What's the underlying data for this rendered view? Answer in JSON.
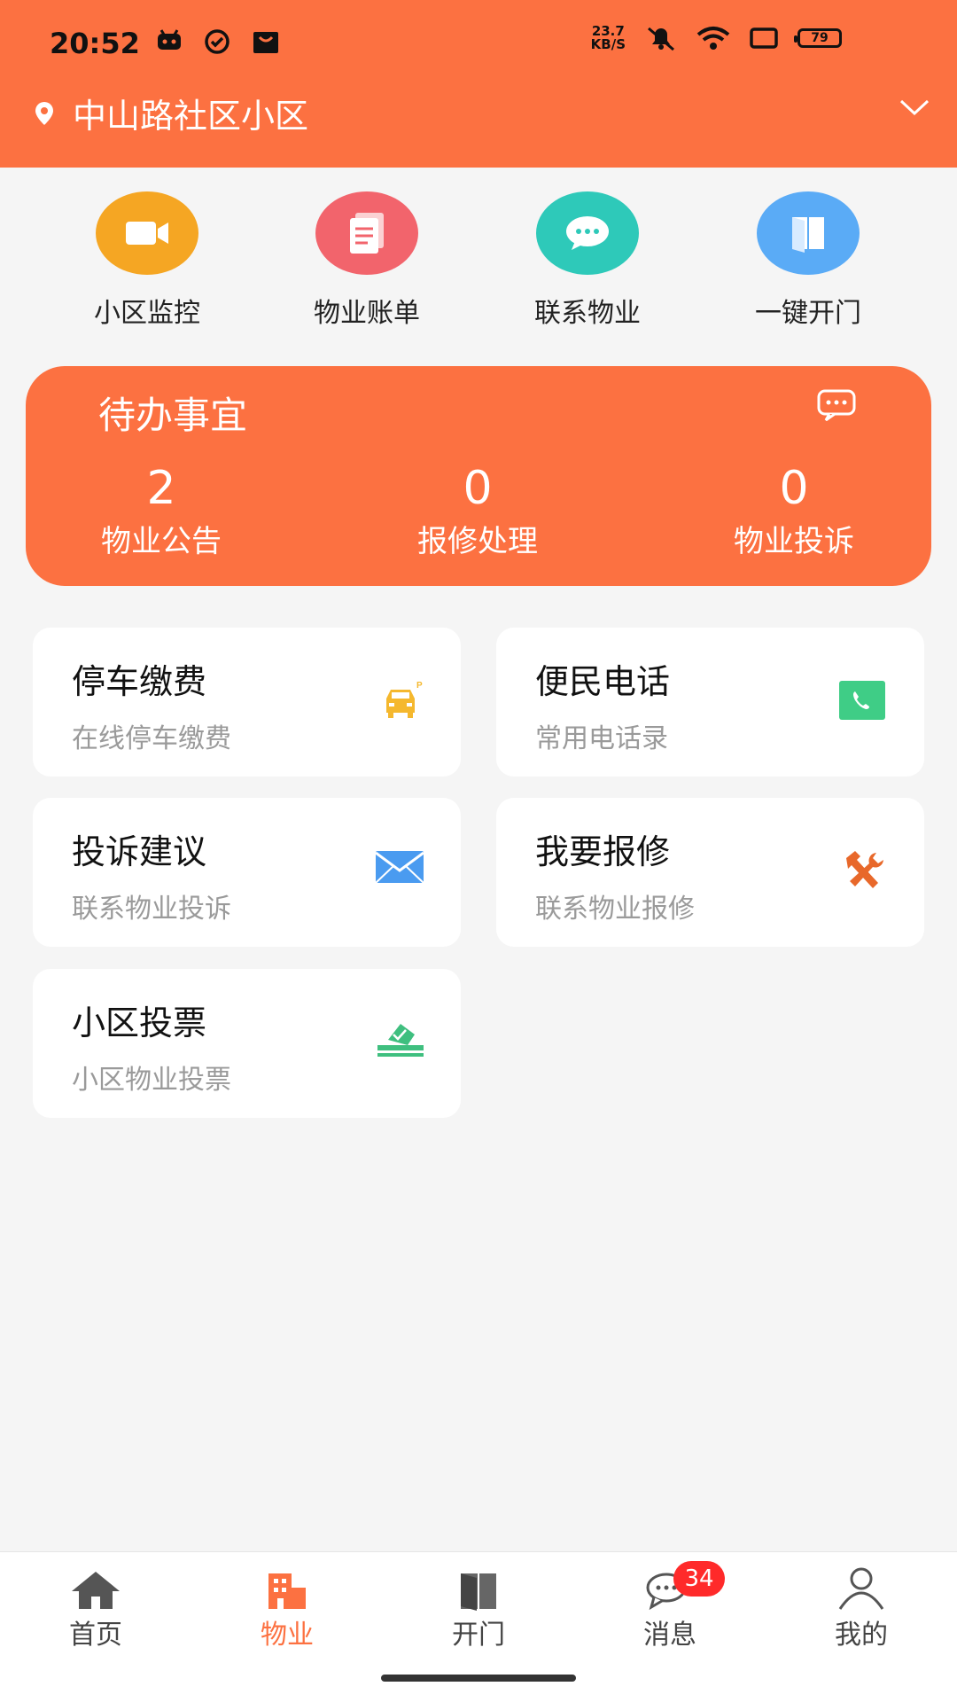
{
  "status_bar": {
    "time": "20:52",
    "net_speed_value": "23.7",
    "net_speed_unit": "KB/S",
    "battery": "79"
  },
  "header": {
    "location": "中山路社区小区"
  },
  "quick_actions": [
    {
      "label": "小区监控",
      "icon": "video-camera-icon",
      "color": "#f5a623"
    },
    {
      "label": "物业账单",
      "icon": "bill-icon",
      "color": "#f2646c"
    },
    {
      "label": "联系物业",
      "icon": "chat-bubble-icon",
      "color": "#2ec9b9"
    },
    {
      "label": "一键开门",
      "icon": "door-icon",
      "color": "#5aabf6"
    }
  ],
  "todo": {
    "title": "待办事宜",
    "stats": [
      {
        "value": "2",
        "label": "物业公告"
      },
      {
        "value": "0",
        "label": "报修处理"
      },
      {
        "value": "0",
        "label": "物业投诉"
      }
    ]
  },
  "services": [
    {
      "title": "停车缴费",
      "subtitle": "在线停车缴费",
      "icon": "car-parking-icon"
    },
    {
      "title": "便民电话",
      "subtitle": "常用电话录",
      "icon": "phone-icon"
    },
    {
      "title": "投诉建议",
      "subtitle": "联系物业投诉",
      "icon": "envelope-icon"
    },
    {
      "title": "我要报修",
      "subtitle": "联系物业报修",
      "icon": "repair-tools-icon"
    },
    {
      "title": "小区投票",
      "subtitle": "小区物业投票",
      "icon": "ballot-box-icon"
    }
  ],
  "tabbar": {
    "tabs": [
      {
        "label": "首页",
        "icon": "home-icon"
      },
      {
        "label": "物业",
        "icon": "building-icon",
        "active": true
      },
      {
        "label": "开门",
        "icon": "door-icon"
      },
      {
        "label": "消息",
        "icon": "message-icon",
        "badge": "34"
      },
      {
        "label": "我的",
        "icon": "user-icon"
      }
    ]
  },
  "colors": {
    "accent": "#fc7141",
    "background": "#f5f5f5"
  }
}
